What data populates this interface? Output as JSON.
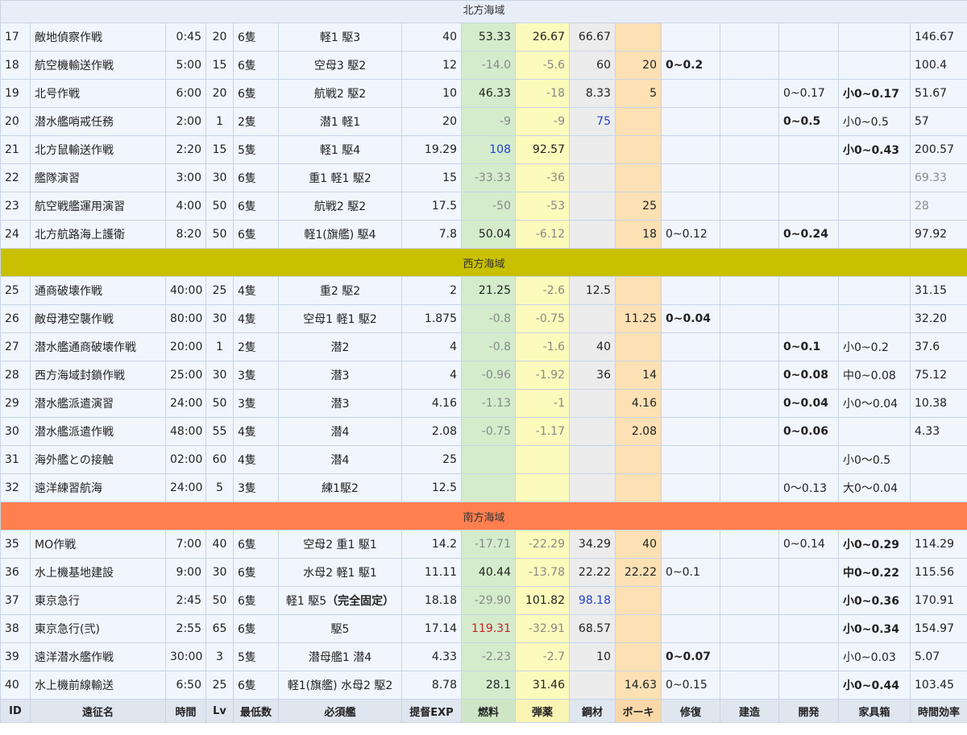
{
  "sections": {
    "north": "北方海域",
    "west": "西方海域",
    "south": "南方海域"
  },
  "columns": [
    "ID",
    "遠征名",
    "時間",
    "Lv",
    "最低数",
    "必須艦",
    "提督EXP",
    "燃料",
    "弾薬",
    "鋼材",
    "ボーキ",
    "修復",
    "建造",
    "開発",
    "家具箱",
    "時間効率"
  ],
  "north_rows": [
    {
      "id": "17",
      "name": "敵地偵察作戦",
      "time": "0:45",
      "lv": "20",
      "min": "6隻",
      "req": "軽1 駆3",
      "exp": "40",
      "fuel": "53.33",
      "ammo": "26.67",
      "steel": "66.67",
      "baux": "",
      "repair": "",
      "build": "",
      "dev": "",
      "box": "",
      "eff": "146.67"
    },
    {
      "id": "18",
      "name": "航空機輸送作戦",
      "time": "5:00",
      "lv": "15",
      "min": "6隻",
      "req": "空母3 駆2",
      "exp": "12",
      "fuel": "-14.0",
      "ammo": "-5.6",
      "steel": "60",
      "baux": "20",
      "repair": "0~0.2",
      "build": "",
      "dev": "",
      "box": "",
      "eff": "100.4"
    },
    {
      "id": "19",
      "name": "北号作戦",
      "time": "6:00",
      "lv": "20",
      "min": "6隻",
      "req": "航戦2 駆2",
      "exp": "10",
      "fuel": "46.33",
      "ammo": "-18",
      "steel": "8.33",
      "baux": "5",
      "repair": "",
      "build": "",
      "dev": "0~0.17",
      "box": "小0~0.17",
      "eff": "51.67"
    },
    {
      "id": "20",
      "name": "潜水艦哨戒任務",
      "time": "2:00",
      "lv": "1",
      "min": "2隻",
      "req": "潜1 軽1",
      "exp": "20",
      "fuel": "-9",
      "ammo": "-9",
      "steel": "75",
      "baux": "",
      "repair": "",
      "build": "",
      "dev": "0~0.5",
      "box": "小0~0.5",
      "eff": "57"
    },
    {
      "id": "21",
      "name": "北方鼠輸送作戦",
      "time": "2:20",
      "lv": "15",
      "min": "5隻",
      "req": "軽1 駆4",
      "exp": "19.29",
      "fuel": "108",
      "ammo": "92.57",
      "steel": "",
      "baux": "",
      "repair": "",
      "build": "",
      "dev": "",
      "box": "小0~0.43",
      "eff": "200.57"
    },
    {
      "id": "22",
      "name": "艦隊演習",
      "time": "3:00",
      "lv": "30",
      "min": "6隻",
      "req": "重1 軽1 駆2",
      "exp": "15",
      "fuel": "-33.33",
      "ammo": "-36",
      "steel": "",
      "baux": "",
      "repair": "",
      "build": "",
      "dev": "",
      "box": "",
      "eff": "69.33"
    },
    {
      "id": "23",
      "name": "航空戦艦運用演習",
      "time": "4:00",
      "lv": "50",
      "min": "6隻",
      "req": "航戦2 駆2",
      "exp": "17.5",
      "fuel": "-50",
      "ammo": "-53",
      "steel": "",
      "baux": "25",
      "repair": "",
      "build": "",
      "dev": "",
      "box": "",
      "eff": "28"
    },
    {
      "id": "24",
      "name": "北方航路海上護衛",
      "time": "8:20",
      "lv": "50",
      "min": "6隻",
      "req": "軽1(旗艦) 駆4",
      "exp": "7.8",
      "fuel": "50.04",
      "ammo": "-6.12",
      "steel": "",
      "baux": "18",
      "repair": "0~0.12",
      "build": "",
      "dev": "0~0.24",
      "box": "",
      "eff": "97.92"
    }
  ],
  "west_rows": [
    {
      "id": "25",
      "name": "通商破壊作戦",
      "time": "40:00",
      "lv": "25",
      "min": "4隻",
      "req": "重2 駆2",
      "exp": "2",
      "fuel": "21.25",
      "ammo": "-2.6",
      "steel": "12.5",
      "baux": "",
      "repair": "",
      "build": "",
      "dev": "",
      "box": "",
      "eff": "31.15"
    },
    {
      "id": "26",
      "name": "敵母港空襲作戦",
      "time": "80:00",
      "lv": "30",
      "min": "4隻",
      "req": "空母1 軽1 駆2",
      "exp": "1.875",
      "fuel": "-0.8",
      "ammo": "-0.75",
      "steel": "",
      "baux": "11.25",
      "repair": "0~0.04",
      "build": "",
      "dev": "",
      "box": "",
      "eff": "32.20"
    },
    {
      "id": "27",
      "name": "潜水艦通商破壊作戦",
      "time": "20:00",
      "lv": "1",
      "min": "2隻",
      "req": "潜2",
      "exp": "4",
      "fuel": "-0.8",
      "ammo": "-1.6",
      "steel": "40",
      "baux": "",
      "repair": "",
      "build": "",
      "dev": "0~0.1",
      "box": "小0~0.2",
      "eff": "37.6"
    },
    {
      "id": "28",
      "name": "西方海域封鎖作戦",
      "time": "25:00",
      "lv": "30",
      "min": "3隻",
      "req": "潜3",
      "exp": "4",
      "fuel": "-0.96",
      "ammo": "-1.92",
      "steel": "36",
      "baux": "14",
      "repair": "",
      "build": "",
      "dev": "0~0.08",
      "box": "中0~0.08",
      "eff": "75.12"
    },
    {
      "id": "29",
      "name": "潜水艦派遣演習",
      "time": "24:00",
      "lv": "50",
      "min": "3隻",
      "req": "潜3",
      "exp": "4.16",
      "fuel": "-1.13",
      "ammo": "-1",
      "steel": "",
      "baux": "4.16",
      "repair": "",
      "build": "",
      "dev": "0~0.04",
      "box": "小0～0.04",
      "eff": "10.38"
    },
    {
      "id": "30",
      "name": "潜水艦派遣作戦",
      "time": "48:00",
      "lv": "55",
      "min": "4隻",
      "req": "潜4",
      "exp": "2.08",
      "fuel": "-0.75",
      "ammo": "-1.17",
      "steel": "",
      "baux": "2.08",
      "repair": "",
      "build": "",
      "dev": "0~0.06",
      "box": "",
      "eff": "4.33"
    },
    {
      "id": "31",
      "name": "海外艦との接触",
      "time": "02:00",
      "lv": "60",
      "min": "4隻",
      "req": "潜4",
      "exp": "25",
      "fuel": "",
      "ammo": "",
      "steel": "",
      "baux": "",
      "repair": "",
      "build": "",
      "dev": "",
      "box": "小0～0.5",
      "eff": ""
    },
    {
      "id": "32",
      "name": "遠洋練習航海",
      "time": "24:00",
      "lv": "5",
      "min": "3隻",
      "req": "練1駆2",
      "exp": "12.5",
      "fuel": "",
      "ammo": "",
      "steel": "",
      "baux": "",
      "repair": "",
      "build": "",
      "dev": "0～0.13",
      "box": "大0～0.04",
      "eff": ""
    }
  ],
  "south_rows": [
    {
      "id": "35",
      "name": "MO作戦",
      "time": "7:00",
      "lv": "40",
      "min": "6隻",
      "req": "空母2 重1 駆1",
      "exp": "14.2",
      "fuel": "-17.71",
      "ammo": "-22.29",
      "steel": "34.29",
      "baux": "40",
      "repair": "",
      "build": "",
      "dev": "0~0.14",
      "box": "小0~0.29",
      "eff": "114.29"
    },
    {
      "id": "36",
      "name": "水上機基地建設",
      "time": "9:00",
      "lv": "30",
      "min": "6隻",
      "req": "水母2 軽1 駆1",
      "exp": "11.11",
      "fuel": "40.44",
      "ammo": "-13.78",
      "steel": "22.22",
      "baux": "22.22",
      "repair": "0~0.1",
      "build": "",
      "dev": "",
      "box": "中0~0.22",
      "eff": "115.56"
    },
    {
      "id": "37",
      "name": "東京急行",
      "time": "2:45",
      "lv": "50",
      "min": "6隻",
      "req": "軽1 駆5",
      "req_bold": "（完全固定）",
      "exp": "18.18",
      "fuel": "-29.90",
      "ammo": "101.82",
      "steel": "98.18",
      "baux": "",
      "repair": "",
      "build": "",
      "dev": "",
      "box": "小0~0.36",
      "eff": "170.91"
    },
    {
      "id": "38",
      "name": "東京急行(弐)",
      "time": "2:55",
      "lv": "65",
      "min": "6隻",
      "req": "駆5",
      "exp": "17.14",
      "fuel": "119.31",
      "ammo": "-32.91",
      "steel": "68.57",
      "baux": "",
      "repair": "",
      "build": "",
      "dev": "",
      "box": "小0~0.34",
      "eff": "154.97"
    },
    {
      "id": "39",
      "name": "遠洋潜水艦作戦",
      "time": "30:00",
      "lv": "3",
      "min": "5隻",
      "req": "潜母艦1 潜4",
      "exp": "4.33",
      "fuel": "-2.23",
      "ammo": "-2.7",
      "steel": "10",
      "baux": "",
      "repair": "0~0.07",
      "build": "",
      "dev": "",
      "box": "小0~0.03",
      "eff": "5.07"
    },
    {
      "id": "40",
      "name": "水上機前線輸送",
      "time": "6:50",
      "lv": "25",
      "min": "6隻",
      "req": "軽1(旗艦) 水母2 駆2",
      "exp": "8.78",
      "fuel": "28.1",
      "ammo": "31.46",
      "steel": "",
      "baux": "14.63",
      "repair": "0~0.15",
      "build": "",
      "dev": "",
      "box": "小0~0.44",
      "eff": "103.45"
    }
  ],
  "colors": {
    "north": "#e8eef8",
    "west": "#c8c000",
    "south": "#ff7f4f",
    "fuel": "#d4eccc",
    "ammo": "#fdfbbc",
    "steel": "#ececec",
    "bauxite": "#fde0b4"
  }
}
